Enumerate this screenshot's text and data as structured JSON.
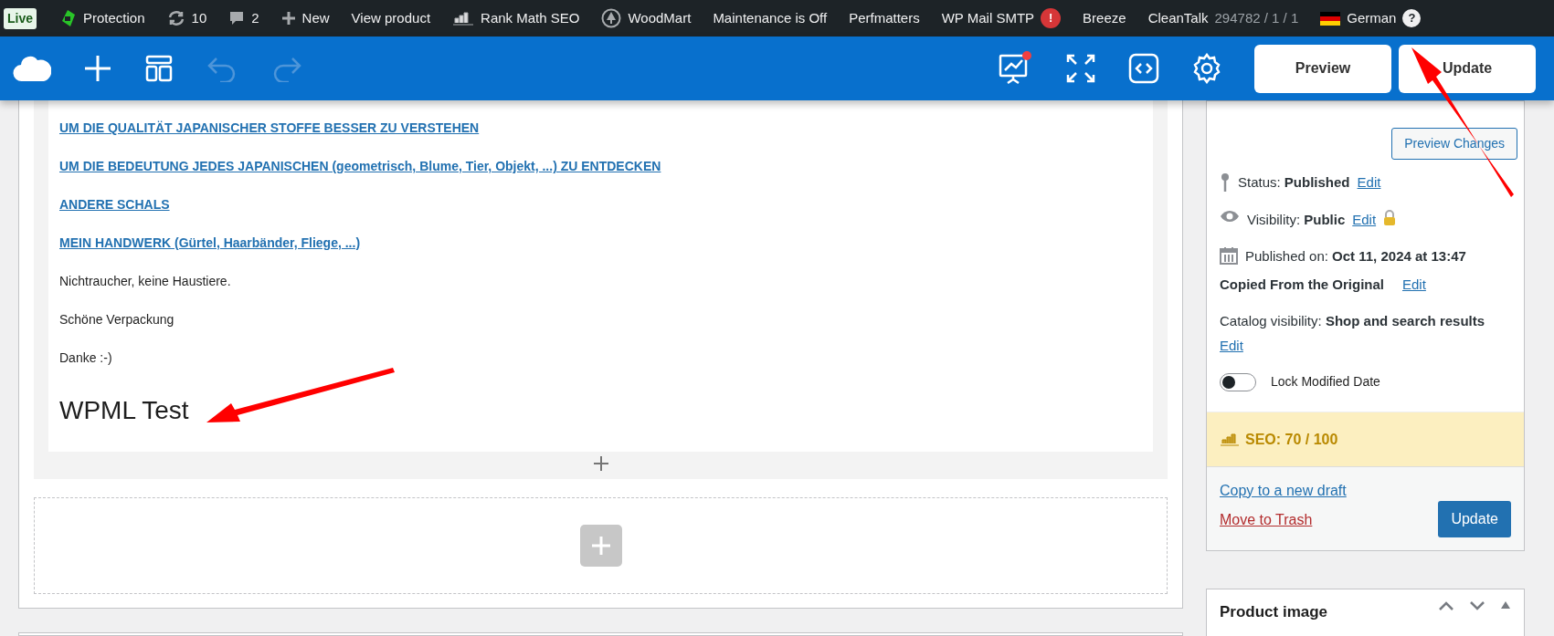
{
  "admin_bar": {
    "items": [
      {
        "label": "Live",
        "kind": "live"
      },
      {
        "label": "Protection",
        "kind": "icon"
      },
      {
        "label": "10",
        "kind": "icon"
      },
      {
        "label": "2",
        "kind": "icon"
      },
      {
        "label": "New",
        "kind": "icon"
      },
      {
        "label": "View product",
        "kind": "text"
      },
      {
        "label": "Rank Math SEO",
        "kind": "icon"
      },
      {
        "label": "WoodMart",
        "kind": "icon"
      },
      {
        "label": "Maintenance is Off",
        "kind": "text"
      },
      {
        "label": "Perfmatters",
        "kind": "text"
      },
      {
        "label": "WP Mail SMTP",
        "kind": "alert",
        "badge": "!"
      },
      {
        "label": "Breeze",
        "kind": "text"
      },
      {
        "label": "CleanTalk",
        "kind": "stats",
        "stats": "294782 / 1 / 1"
      },
      {
        "label": "German",
        "kind": "language",
        "help": "?"
      }
    ]
  },
  "editor_toolbar": {
    "buttons": [
      {
        "label": "Preview"
      },
      {
        "label": "Update"
      }
    ]
  },
  "content": {
    "blocks": [
      {
        "kind": "link",
        "text": "UM DIE QUALITÄT JAPANISCHER STOFFE BESSER ZU VERSTEHEN"
      },
      {
        "kind": "link",
        "text": "UM DIE BEDEUTUNG JEDES JAPANISCHEN (geometrisch, Blume, Tier, Objekt, ...) ZU ENTDECKEN"
      },
      {
        "kind": "link",
        "text": "ANDERE SCHALS"
      },
      {
        "kind": "link",
        "text": "MEIN HANDWERK (Gürtel, Haarbänder, Fliege, ...)"
      },
      {
        "kind": "paragraph",
        "text": "Nichtraucher, keine Haustiere."
      },
      {
        "kind": "paragraph",
        "text": "Schöne Verpackung"
      },
      {
        "kind": "paragraph",
        "text": "Danke  :-)"
      },
      {
        "kind": "heading",
        "text": "WPML Test"
      }
    ]
  },
  "publish_box": {
    "preview_button": "Preview Changes",
    "rows": [
      {
        "kind": "status",
        "text": "Status: **Published**",
        "link": "Edit"
      },
      {
        "kind": "visibility",
        "text": "Visibility: **Public**",
        "link": "Edit"
      },
      {
        "kind": "date",
        "text": "Published on: **Oct 11, 2024 at 13:47**",
        "note": "Copied From the Original",
        "link": "Edit"
      },
      {
        "kind": "catalog",
        "text": "Catalog visibility: **Shop and search results**",
        "link": "Edit"
      }
    ],
    "toggle": {
      "label": "Lock Modified Date",
      "on": false
    },
    "seo": "SEO: 70 / 100",
    "copy_link": "Copy to a new draft",
    "trash_link": "Move to Trash",
    "update_button": "Update"
  },
  "product_image_box": {
    "title": "Product image"
  }
}
